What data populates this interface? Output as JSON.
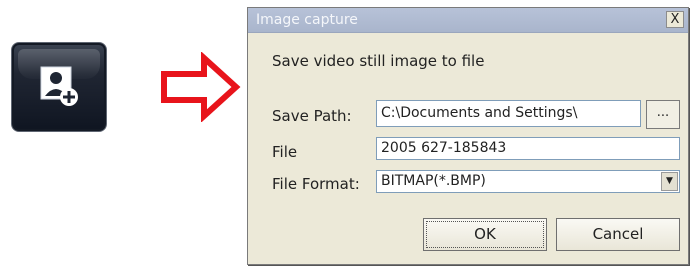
{
  "dialog": {
    "title": "Image capture",
    "close_glyph": "X",
    "description": "Save video still image to file",
    "save_path_label": "Save Path:",
    "save_path_value": "C:\\Documents and Settings\\",
    "browse_label": "...",
    "file_label": "File",
    "file_value": "2005 627-185843",
    "format_label": "File Format:",
    "format_value": "BITMAP(*.BMP)",
    "ok_label": "OK",
    "cancel_label": "Cancel"
  },
  "colors": {
    "arrow": "#e8141b",
    "dialog_bg": "#ece9d8"
  },
  "icons": {
    "tool_button": "snapshot-person-plus-icon",
    "arrow": "right-arrow-icon"
  }
}
